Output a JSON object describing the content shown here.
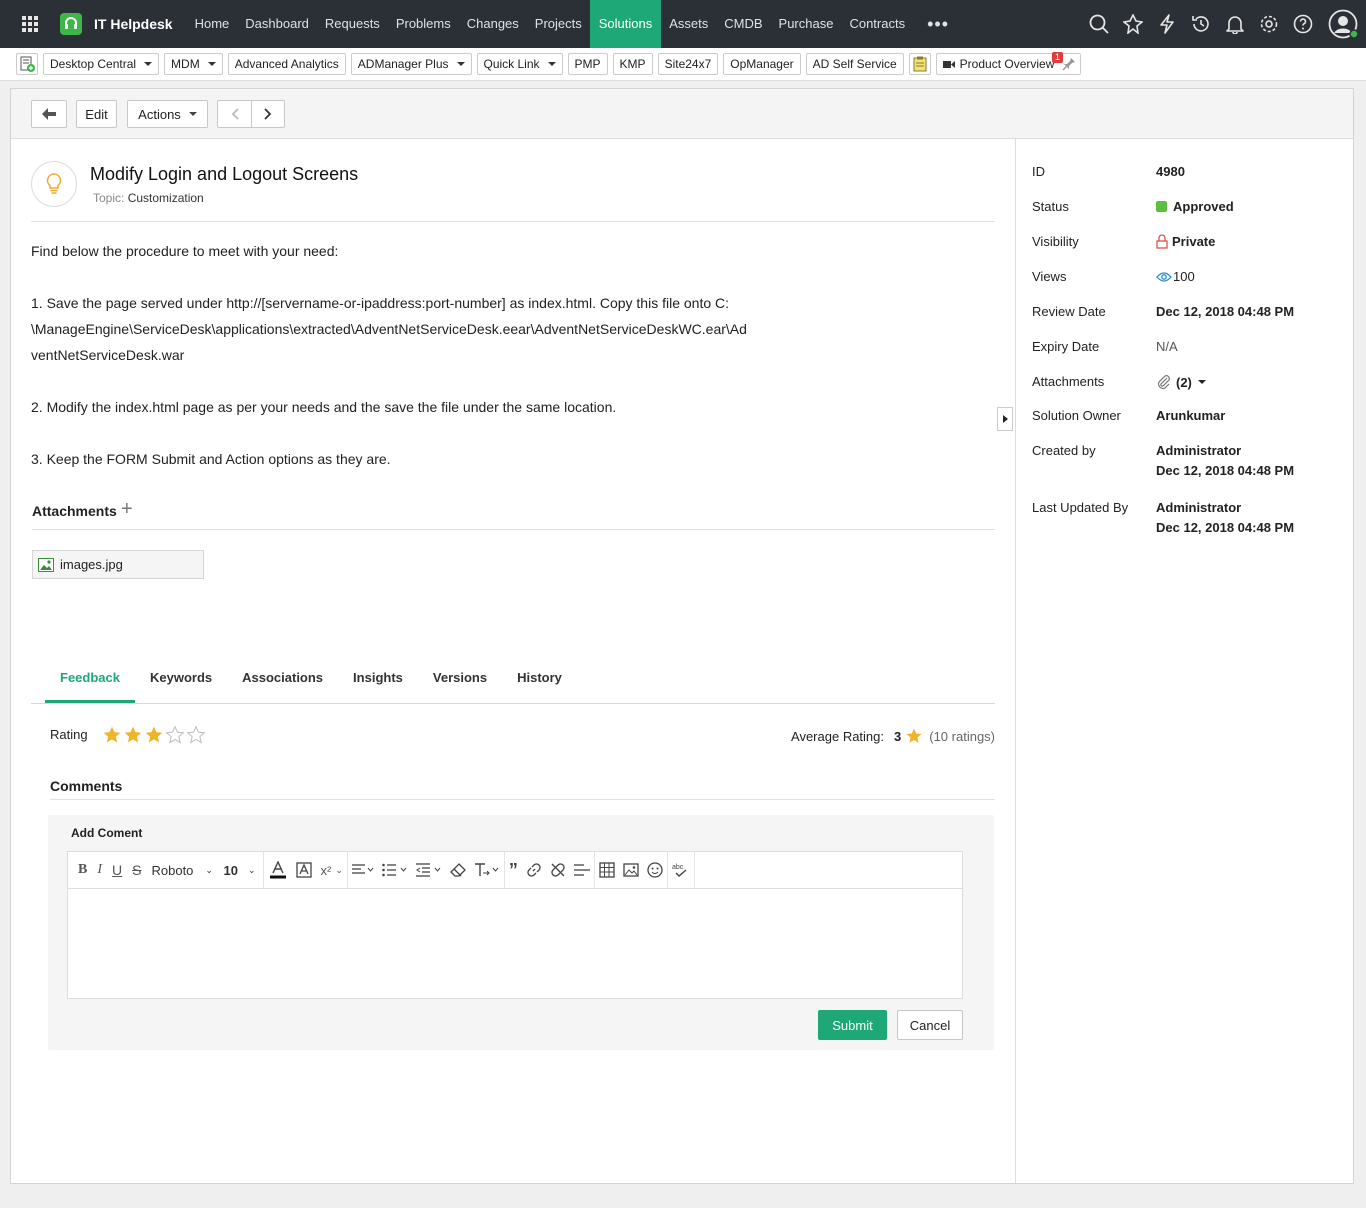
{
  "app": {
    "brand": "IT Helpdesk"
  },
  "nav": {
    "items": [
      "Home",
      "Dashboard",
      "Requests",
      "Problems",
      "Changes",
      "Projects",
      "Solutions",
      "Assets",
      "CMDB",
      "Purchase",
      "Contracts"
    ],
    "active": "Solutions",
    "more": "•••"
  },
  "quickbar": {
    "items": [
      {
        "label": "Desktop Central",
        "dropdown": true
      },
      {
        "label": "MDM",
        "dropdown": true
      },
      {
        "label": "Advanced Analytics",
        "dropdown": false
      },
      {
        "label": "ADManager Plus",
        "dropdown": true
      },
      {
        "label": "Quick Link",
        "dropdown": true
      },
      {
        "label": "PMP",
        "dropdown": false
      },
      {
        "label": "KMP",
        "dropdown": false
      },
      {
        "label": "Site24x7",
        "dropdown": false
      },
      {
        "label": "OpManager",
        "dropdown": false
      },
      {
        "label": "AD Self Service",
        "dropdown": false
      }
    ],
    "product_overview": "Product Overview",
    "badge": "1"
  },
  "toolbar": {
    "edit": "Edit",
    "actions": "Actions"
  },
  "solution": {
    "title": "Modify Login and Logout Screens",
    "topic_label": "Topic:",
    "topic": "Customization",
    "body": {
      "intro": "Find below the procedure to meet with your need:",
      "step1_line1": "1. Save the page served under http://[servername-or-ipaddress:port-number] as index.html. Copy this file onto C:",
      "step1_line2": "\\ManageEngine\\ServiceDesk\\applications\\extracted\\AdventNetServiceDesk.eear\\AdventNetServiceDeskWC.ear\\Ad",
      "step1_line3": "ventNetServiceDesk.war",
      "step2": "2. Modify the index.html page as per your needs and the save the file under the same location.",
      "step3": "3. Keep the FORM Submit and Action options as they are."
    }
  },
  "attachments": {
    "heading": "Attachments",
    "plus": "+",
    "file": "images.jpg"
  },
  "tabs": [
    "Feedback",
    "Keywords",
    "Associations",
    "Insights",
    "Versions",
    "History"
  ],
  "feedback": {
    "rating_label": "Rating",
    "rating": 3,
    "max_rating": 5,
    "average_label": "Average Rating:",
    "average": "3",
    "count": "(10 ratings)"
  },
  "comments": {
    "heading": "Comments",
    "add_label": "Add Coment",
    "font": "Roboto",
    "font_size": "10",
    "submit": "Submit",
    "cancel": "Cancel"
  },
  "properties": {
    "id": {
      "label": "ID",
      "value": "4980"
    },
    "status": {
      "label": "Status",
      "value": "Approved",
      "color": "#5cbf3f"
    },
    "visibility": {
      "label": "Visibility",
      "value": "Private"
    },
    "views": {
      "label": "Views",
      "value": "100"
    },
    "review_date": {
      "label": "Review Date",
      "value": "Dec 12, 2018 04:48 PM"
    },
    "expiry_date": {
      "label": "Expiry Date",
      "value": "N/A"
    },
    "attachments": {
      "label": "Attachments",
      "value": "(2)"
    },
    "owner": {
      "label": "Solution Owner",
      "value": "Arunkumar"
    },
    "created_by": {
      "label": "Created by",
      "value": "Administrator",
      "date": "Dec 12, 2018 04:48 PM"
    },
    "updated_by": {
      "label": "Last Updated By",
      "value": "Administrator",
      "date": "Dec 12, 2018 04:48 PM"
    }
  },
  "colors": {
    "accent": "#1ea878",
    "nav_bg": "#2b2f36",
    "star": "#f0b429",
    "danger": "#e23b3b"
  },
  "icons": [
    "app-grid-icon",
    "headset-logo-icon",
    "search-icon",
    "rocket-icon",
    "lightning-icon",
    "history-icon",
    "bell-icon",
    "gear-icon",
    "help-icon",
    "avatar-icon",
    "new-request-icon",
    "notes-icon",
    "video-icon",
    "pin-icon",
    "back-arrow-icon",
    "prev-icon",
    "next-icon",
    "lightbulb-icon",
    "image-file-icon",
    "star-icon",
    "lock-icon",
    "eye-icon",
    "paperclip-icon",
    "collapse-arrow-icon"
  ]
}
